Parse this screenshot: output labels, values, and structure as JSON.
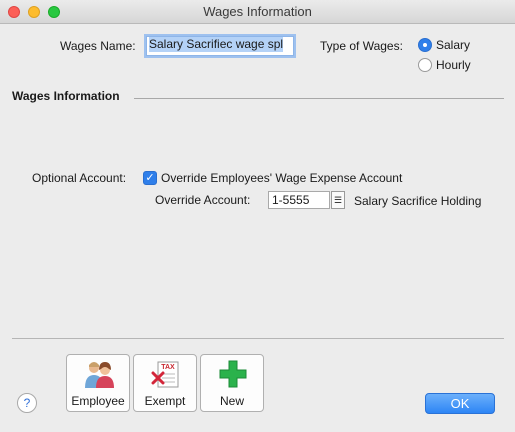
{
  "window": {
    "title": "Wages Information"
  },
  "form": {
    "wages_name_label": "Wages Name:",
    "wages_name_value": "Salary Sacrifiec wage spl",
    "type_label": "Type of Wages:",
    "type_options": [
      {
        "label": "Salary",
        "selected": true
      },
      {
        "label": "Hourly",
        "selected": false
      }
    ]
  },
  "section": {
    "heading": "Wages Information"
  },
  "optional": {
    "label": "Optional Account:",
    "checkbox_label": "Override Employees' Wage Expense Account",
    "checked": true,
    "override_label": "Override Account:",
    "account_number": "1-5555",
    "account_name": "Salary Sacrifice Holding"
  },
  "toolbar": {
    "buttons": [
      {
        "label": "Employee",
        "icon": "employees-icon"
      },
      {
        "label": "Exempt",
        "icon": "tax-exempt-icon",
        "badge": "TAX"
      },
      {
        "label": "New",
        "icon": "plus-icon"
      }
    ]
  },
  "footer": {
    "help_label": "?",
    "ok_label": "OK"
  },
  "colors": {
    "accent": "#2f7fea",
    "ok_button": "#3b8ff7",
    "plus_green": "#2bb24c"
  }
}
